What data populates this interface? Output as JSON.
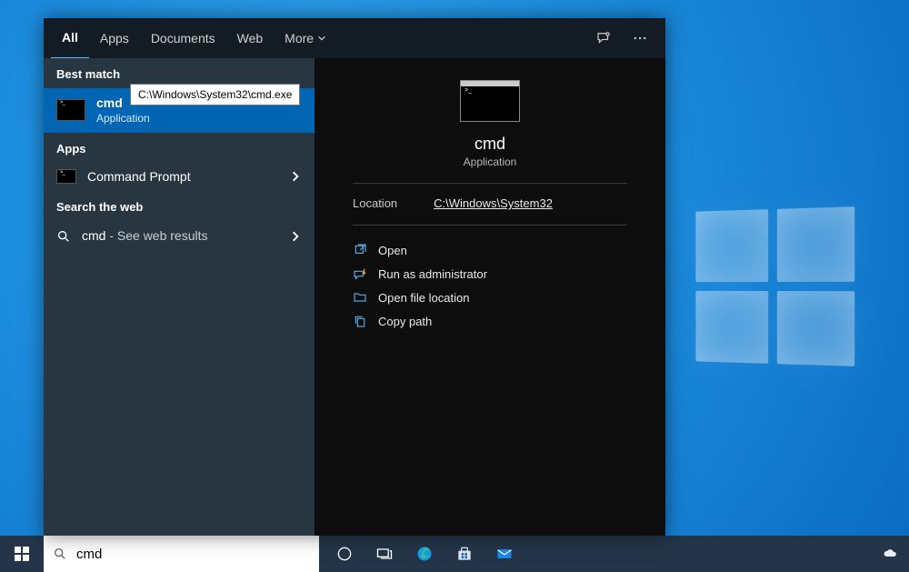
{
  "tabs": {
    "all": "All",
    "apps": "Apps",
    "documents": "Documents",
    "web": "Web",
    "more": "More"
  },
  "sections": {
    "best_match": "Best match",
    "apps": "Apps",
    "search_web": "Search the web"
  },
  "tooltip": "C:\\Windows\\System32\\cmd.exe",
  "best_match": {
    "title": "cmd",
    "subtitle": "Application"
  },
  "apps_results": {
    "item0": {
      "title": "Command Prompt"
    }
  },
  "web_results": {
    "item0": {
      "query": "cmd",
      "suffix": " - See web results"
    }
  },
  "detail": {
    "title": "cmd",
    "subtitle": "Application",
    "meta": {
      "location_label": "Location",
      "location_value": "C:\\Windows\\System32"
    },
    "actions": {
      "open": "Open",
      "run_admin": "Run as administrator",
      "open_location": "Open file location",
      "copy_path": "Copy path"
    }
  },
  "searchbox": {
    "value": "cmd"
  }
}
